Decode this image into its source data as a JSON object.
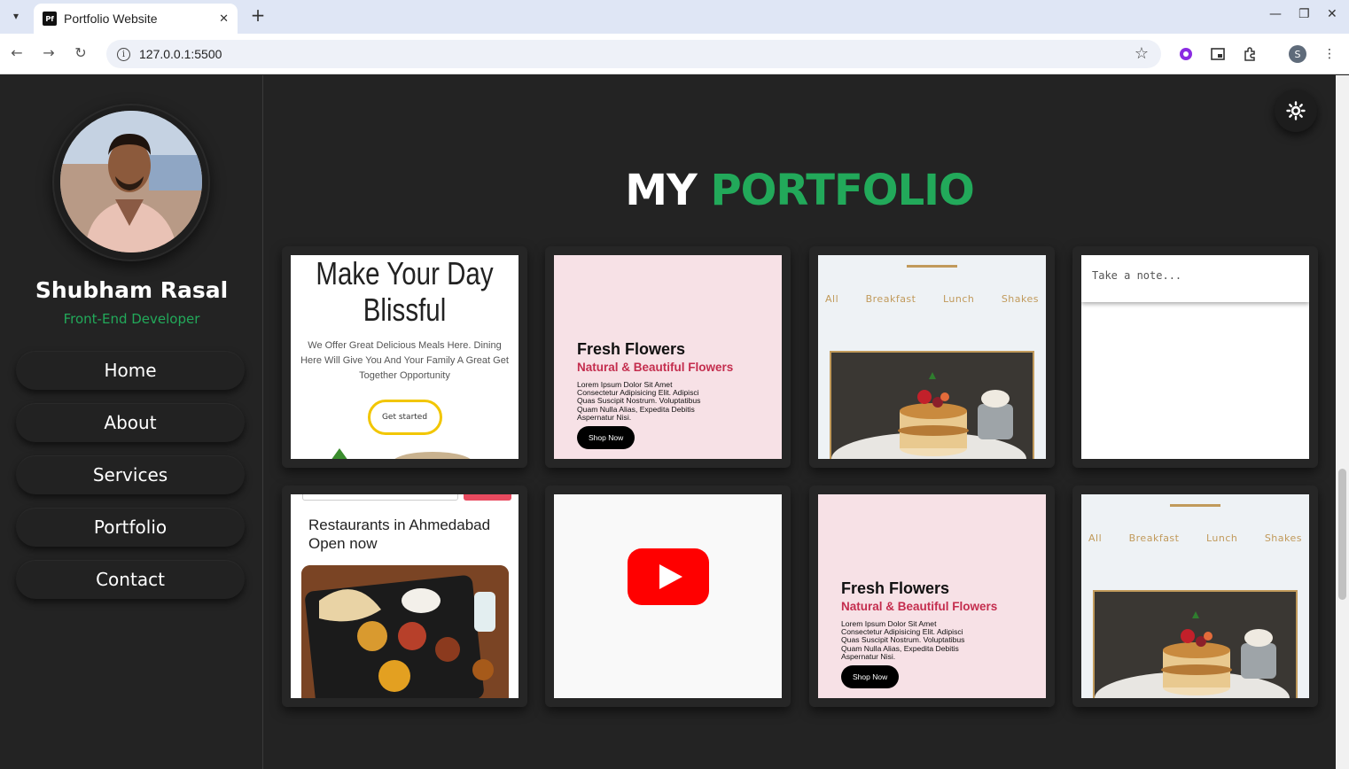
{
  "browser": {
    "tab_title": "Portfolio Website",
    "favicon_text": "Pf",
    "url": "127.0.0.1:5500",
    "profile_initial": "S"
  },
  "sidebar": {
    "name": "Shubham Rasal",
    "role": "Front-End Developer",
    "nav": [
      "Home",
      "About",
      "Services",
      "Portfolio",
      "Contact"
    ]
  },
  "main": {
    "heading_white": "MY",
    "heading_green": "PORTFOLIO"
  },
  "cards": {
    "food": {
      "title": "Make Your Day Blissful",
      "text": "We Offer Great Delicious Meals Here. Dining Here Will Give You And Your Family A Great Get Together Opportunity",
      "button": "Get started"
    },
    "flowers": {
      "title": "Fresh Flowers",
      "subtitle": "Natural & Beautiful Flowers",
      "text": "Lorem Ipsum Dolor Sit Amet Consectetur Adipisicing Elit. Adipisci Quas Suscipit Nostrum. Voluptatibus Quam Nulla Alias, Expedita Debitis Aspernatur Nisi.",
      "button": "Shop Now"
    },
    "menu": {
      "categories": [
        "All",
        "Breakfast",
        "Lunch",
        "Shakes"
      ]
    },
    "note": {
      "placeholder": "Take a note..."
    },
    "restaurant": {
      "title": "Restaurants in Ahmedabad Open now"
    }
  },
  "colors": {
    "accent_green": "#22a95a",
    "background": "#232323",
    "flower_pink": "#c42d4e",
    "menu_gold": "#c19a5b"
  }
}
